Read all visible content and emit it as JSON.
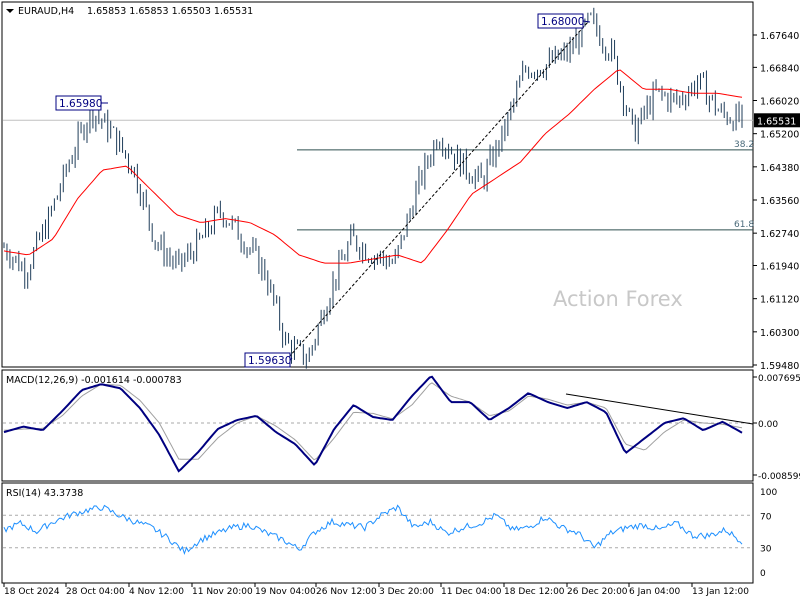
{
  "header": {
    "symbol": "EURAUD,H4",
    "ohlc": "1.65853 1.65853 1.65503 1.65531"
  },
  "watermark": "Action Forex",
  "colors": {
    "bars": "#1f3d5a",
    "ma": "#ff0000",
    "macd": "#000080",
    "signal": "#a0a0a0",
    "rsi": "#1e90ff",
    "bg": "#ffffff"
  },
  "chart_data": [
    {
      "type": "line",
      "title": "EURAUD,H4",
      "ylim": [
        1.5948,
        1.6806
      ],
      "price_ticks": [
        "1.67640",
        "1.66840",
        "1.66020",
        "1.65200",
        "1.64380",
        "1.63560",
        "1.62740",
        "1.61940",
        "1.61120",
        "1.60300",
        "1.59480"
      ],
      "price_tick_values": [
        1.6764,
        1.6684,
        1.6602,
        1.652,
        1.6438,
        1.6356,
        1.6274,
        1.6194,
        1.6112,
        1.603,
        1.5948
      ],
      "current_price": "1.65531",
      "current_price_value": 1.65531,
      "annotations": [
        {
          "label": "1.65980",
          "value": 1.6598
        },
        {
          "label": "1.68000",
          "value": 1.68
        },
        {
          "label": "1.59630",
          "value": 1.5963
        }
      ],
      "fib_levels": [
        {
          "label": "38.2",
          "value": 1.648
        },
        {
          "label": "61.8",
          "value": 1.6282
        }
      ],
      "close_path": [
        1.624,
        1.618,
        1.63,
        1.645,
        1.658,
        1.652,
        1.643,
        1.625,
        1.619,
        1.625,
        1.633,
        1.626,
        1.618,
        1.6,
        1.5963,
        1.613,
        1.626,
        1.622,
        1.62,
        1.638,
        1.652,
        1.645,
        1.64,
        1.652,
        1.668,
        1.669,
        1.672,
        1.68,
        1.672,
        1.652,
        1.662,
        1.66,
        1.665,
        1.657,
        1.6553
      ],
      "ma_path": [
        1.623,
        1.622,
        1.626,
        1.636,
        1.643,
        1.644,
        1.638,
        1.632,
        1.63,
        1.631,
        1.63,
        1.627,
        1.622,
        1.62,
        1.62,
        1.621,
        1.622,
        1.62,
        1.628,
        1.637,
        1.641,
        1.645,
        1.652,
        1.657,
        1.663,
        1.668,
        1.663,
        1.663,
        1.662,
        1.662,
        1.661
      ]
    },
    {
      "type": "line",
      "title": "MACD(12,26,9) -0.001614 -0.000783",
      "ylim": [
        -0.008599,
        0.007695
      ],
      "ticks": [
        "0.007695",
        "0.00",
        "-0.008599"
      ],
      "macd": [
        -0.0015,
        -0.0006,
        -0.0012,
        0.002,
        0.0055,
        0.0065,
        0.0058,
        0.0025,
        -0.002,
        -0.008,
        -0.0048,
        -0.001,
        0.0005,
        0.0012,
        -0.0015,
        -0.0035,
        -0.007,
        -0.001,
        0.003,
        0.001,
        0.0005,
        0.0045,
        0.0079,
        0.0035,
        0.0035,
        0.0005,
        0.0025,
        0.005,
        0.0035,
        0.0025,
        0.0035,
        0.0018,
        -0.005,
        -0.0025,
        0,
        0.0008,
        -0.0012,
        0.0002,
        -0.0016
      ],
      "signal": [
        -0.0012,
        -0.001,
        -0.0009,
        0.0012,
        0.0045,
        0.0065,
        0.0063,
        0.0038,
        0,
        -0.006,
        -0.006,
        -0.0025,
        0,
        0.0012,
        -0.0005,
        -0.0028,
        -0.0062,
        -0.0025,
        0.0018,
        0.0016,
        0.0007,
        0.003,
        0.0068,
        0.0045,
        0.0035,
        0.0012,
        0.002,
        0.0045,
        0.004,
        0.003,
        0.0035,
        0.0025,
        -0.0035,
        -0.0045,
        -0.0015,
        0.0005,
        0,
        -0.0002,
        -0.0008
      ]
    },
    {
      "type": "line",
      "title": "RSI(14) 43.3738",
      "ylim": [
        0,
        100
      ],
      "ticks": [
        "100",
        "70",
        "30",
        "0"
      ],
      "levels": [
        70,
        30
      ],
      "values": [
        52,
        60,
        50,
        62,
        70,
        76,
        80,
        70,
        62,
        55,
        42,
        25,
        40,
        48,
        55,
        58,
        48,
        40,
        28,
        50,
        62,
        58,
        55,
        70,
        80,
        55,
        62,
        48,
        55,
        60,
        70,
        52,
        55,
        68,
        55,
        48,
        30,
        48,
        55,
        58,
        52,
        60,
        45,
        45,
        52,
        38
      ]
    },
    {
      "type": "table",
      "x_tick_labels": [
        "18 Oct 2024",
        "28 Oct 04:00",
        "4 Nov 12:00",
        "11 Nov 20:00",
        "19 Nov 04:00",
        "26 Nov 12:00",
        "3 Dec 20:00",
        "11 Dec 04:00",
        "18 Dec 12:00",
        "26 Dec 20:00",
        "6 Jan 04:00",
        "13 Jan 12:00"
      ]
    }
  ]
}
